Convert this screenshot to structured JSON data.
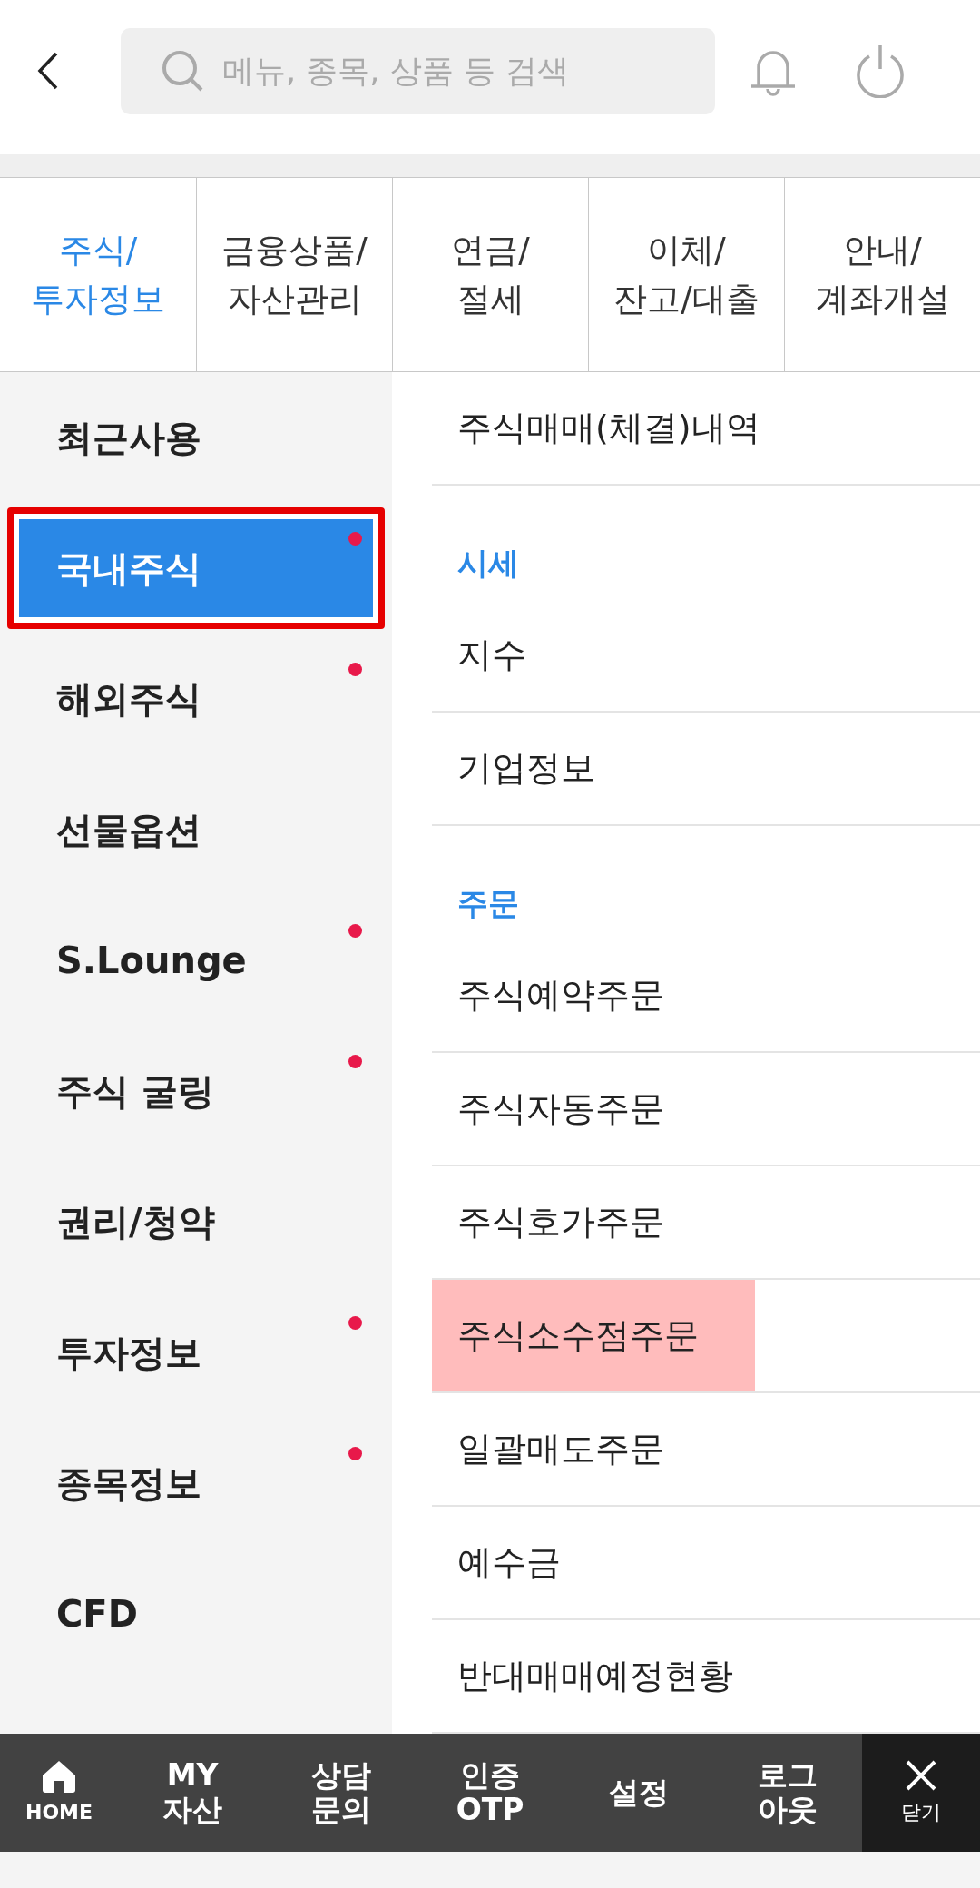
{
  "header": {
    "search": {
      "placeholder": "메뉴, 종목, 상품 등 검색"
    }
  },
  "tabs": [
    {
      "label": "주식/\n투자정보",
      "selected": true
    },
    {
      "label": "금융상품/\n자산관리",
      "selected": false
    },
    {
      "label": "연금/\n절세",
      "selected": false
    },
    {
      "label": "이체/\n잔고/대출",
      "selected": false
    },
    {
      "label": "안내/\n계좌개설",
      "selected": false
    }
  ],
  "sidebar": {
    "items": [
      {
        "label": "최근사용",
        "selected": false,
        "dot": false,
        "highlighted": false
      },
      {
        "label": "국내주식",
        "selected": true,
        "dot": true,
        "highlighted": true
      },
      {
        "label": "해외주식",
        "selected": false,
        "dot": true,
        "highlighted": false
      },
      {
        "label": "선물옵션",
        "selected": false,
        "dot": false,
        "highlighted": false
      },
      {
        "label": "S.Lounge",
        "selected": false,
        "dot": true,
        "highlighted": false
      },
      {
        "label": "주식 굴링",
        "selected": false,
        "dot": true,
        "highlighted": false
      },
      {
        "label": "권리/청약",
        "selected": false,
        "dot": false,
        "highlighted": false
      },
      {
        "label": "투자정보",
        "selected": false,
        "dot": true,
        "highlighted": false
      },
      {
        "label": "종목정보",
        "selected": false,
        "dot": true,
        "highlighted": false
      },
      {
        "label": "CFD",
        "selected": false,
        "dot": false,
        "highlighted": false
      }
    ]
  },
  "menu": [
    {
      "kind": "item",
      "label": "주식매매(체결)내역",
      "highlighted": false
    },
    {
      "kind": "section",
      "label": "시세"
    },
    {
      "kind": "item",
      "label": "지수",
      "highlighted": false
    },
    {
      "kind": "item",
      "label": "기업정보",
      "highlighted": false
    },
    {
      "kind": "section",
      "label": "주문"
    },
    {
      "kind": "item",
      "label": "주식예약주문",
      "highlighted": false
    },
    {
      "kind": "item",
      "label": "주식자동주문",
      "highlighted": false
    },
    {
      "kind": "item",
      "label": "주식호가주문",
      "highlighted": false
    },
    {
      "kind": "item",
      "label": "주식소수점주문",
      "highlighted": true
    },
    {
      "kind": "item",
      "label": "일괄매도주문",
      "highlighted": false
    },
    {
      "kind": "item",
      "label": "예수금",
      "highlighted": false
    },
    {
      "kind": "item",
      "label": "반대매매예정현황",
      "highlighted": false
    }
  ],
  "bottom_bar": {
    "items": [
      {
        "kind": "home",
        "label": "HOME"
      },
      {
        "kind": "text",
        "label": "MY\n자산"
      },
      {
        "kind": "text",
        "label": "상담\n문의"
      },
      {
        "kind": "text",
        "label": "인증\nOTP"
      },
      {
        "kind": "text",
        "label": "설정"
      },
      {
        "kind": "text",
        "label": "로그\n아웃"
      },
      {
        "kind": "close",
        "label": "닫기"
      }
    ]
  }
}
